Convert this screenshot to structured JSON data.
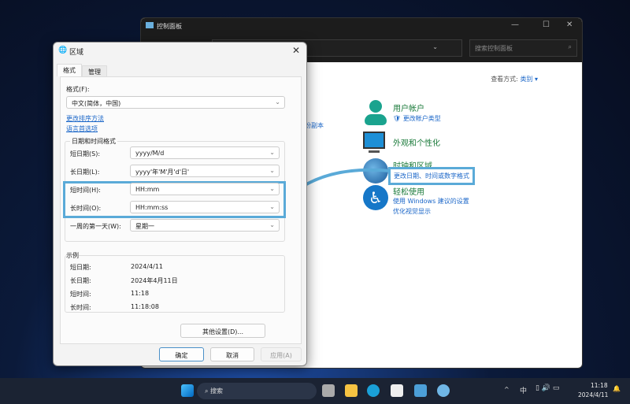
{
  "control_panel": {
    "title": "控制面板",
    "search_placeholder": "搜索控制面板",
    "view_by_label": "查看方式:",
    "view_by_value": "类别 ▾",
    "partial_text": "份副本",
    "categories": [
      {
        "title": "用户帐户",
        "links": [
          "更改帐户类型"
        ]
      },
      {
        "title": "外观和个性化",
        "links": []
      },
      {
        "title": "时钟和区域",
        "links": [
          "更改日期、时间或数字格式"
        ]
      },
      {
        "title": "轻松使用",
        "links": [
          "使用 Windows 建议的设置",
          "优化视觉显示"
        ]
      }
    ]
  },
  "dialog": {
    "title": "区域",
    "tabs": [
      "格式",
      "管理"
    ],
    "format_label": "格式(F):",
    "format_value": "中文(简体，中国)",
    "link_sort": "更改排序方法",
    "link_lang": "语言首选项",
    "group_title": "日期和时间格式",
    "rows": [
      {
        "label": "短日期(S):",
        "value": "yyyy/M/d"
      },
      {
        "label": "长日期(L):",
        "value": "yyyy'年'M'月'd'日'"
      },
      {
        "label": "短时间(H):",
        "value": "HH:mm"
      },
      {
        "label": "长时间(O):",
        "value": "HH:mm:ss"
      },
      {
        "label": "一周的第一天(W):",
        "value": "星期一"
      }
    ],
    "example_title": "示例",
    "examples": [
      {
        "label": "短日期:",
        "value": "2024/4/11"
      },
      {
        "label": "长日期:",
        "value": "2024年4月11日"
      },
      {
        "label": "短时间:",
        "value": "11:18"
      },
      {
        "label": "长时间:",
        "value": "11:18:08"
      }
    ],
    "other_settings": "其他设置(D)...",
    "ok": "确定",
    "cancel": "取消",
    "apply": "应用(A)"
  },
  "taskbar": {
    "search": "搜索",
    "ime": "中",
    "time": "11:18",
    "date": "2024/4/11"
  },
  "colors": {
    "highlight": "#5aaad8",
    "link": "#1a66c8"
  }
}
